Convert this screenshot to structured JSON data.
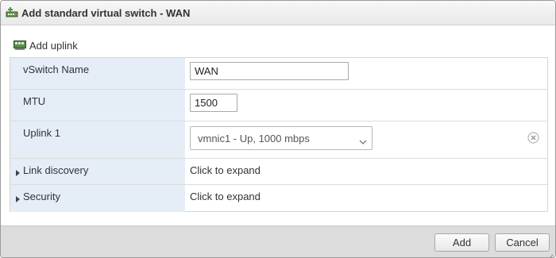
{
  "dialog": {
    "title": "Add standard virtual switch - WAN"
  },
  "toolbar": {
    "add_uplink_label": "Add uplink"
  },
  "form": {
    "vswitch_name": {
      "label": "vSwitch Name",
      "value": "WAN"
    },
    "mtu": {
      "label": "MTU",
      "value": "1500"
    },
    "uplink1": {
      "label": "Uplink 1",
      "selected": "vmnic1 - Up, 1000 mbps"
    },
    "link_discovery": {
      "label": "Link discovery",
      "value": "Click to expand"
    },
    "security": {
      "label": "Security",
      "value": "Click to expand"
    }
  },
  "footer": {
    "add_label": "Add",
    "cancel_label": "Cancel"
  },
  "icons": {
    "title": "vswitch-add-icon",
    "add_uplink": "network-card-icon",
    "clear": "clear-circle-icon",
    "dropdown": "chevron-down-icon",
    "expand": "caret-right-icon"
  },
  "colors": {
    "label_background": "#e5eef6",
    "footer_background": "#dcdcdc",
    "titlebar_background": "#efefef"
  }
}
